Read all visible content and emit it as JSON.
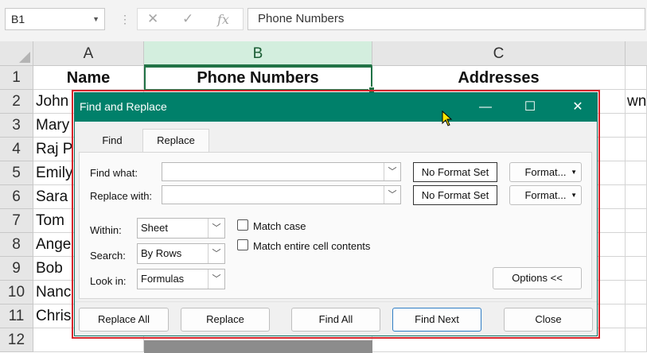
{
  "formula_bar": {
    "name_box": "B1",
    "cancel_icon": "✕",
    "enter_icon": "✓",
    "function_icon": "fx",
    "formula": "Phone Numbers"
  },
  "columns": [
    {
      "label": "A"
    },
    {
      "label": "B"
    },
    {
      "label": "C"
    }
  ],
  "rows": [
    "1",
    "2",
    "3",
    "4",
    "5",
    "6",
    "7",
    "8",
    "9",
    "10",
    "11",
    "12"
  ],
  "sheet": {
    "headers": [
      "Name",
      "Phone Numbers",
      "Addresses"
    ],
    "col_a": [
      "John",
      "Mary",
      "Raj P",
      "Emily",
      "Sara",
      "Tom",
      "Ange",
      "Bob",
      "Nanc",
      "Chris"
    ],
    "c2_overflow": "wn"
  },
  "dialog": {
    "title": "Find and Replace",
    "title_buttons": {
      "minimize": "—",
      "maximize": "☐",
      "close": "✕"
    },
    "tabs": {
      "find": "Find",
      "replace": "Replace"
    },
    "find_what_label": "Find what:",
    "find_what_value": "",
    "replace_with_label": "Replace with:",
    "replace_with_value": "",
    "no_format_1": "No Format Set",
    "no_format_2": "No Format Set",
    "format_button_1": "Format...",
    "format_button_2": "Format...",
    "within_label": "Within:",
    "within_value": "Sheet",
    "search_label": "Search:",
    "search_value": "By Rows",
    "look_in_label": "Look in:",
    "look_in_value": "Formulas",
    "match_case": "Match case",
    "match_entire": "Match entire cell contents",
    "options_button": "Options <<",
    "buttons": {
      "replace_all": "Replace All",
      "replace": "Replace",
      "find_all": "Find All",
      "find_next": "Find Next",
      "close": "Close"
    }
  },
  "colors": {
    "title_bar": "#00806a",
    "selection": "#217346",
    "highlight_outline": "#d7262c"
  }
}
